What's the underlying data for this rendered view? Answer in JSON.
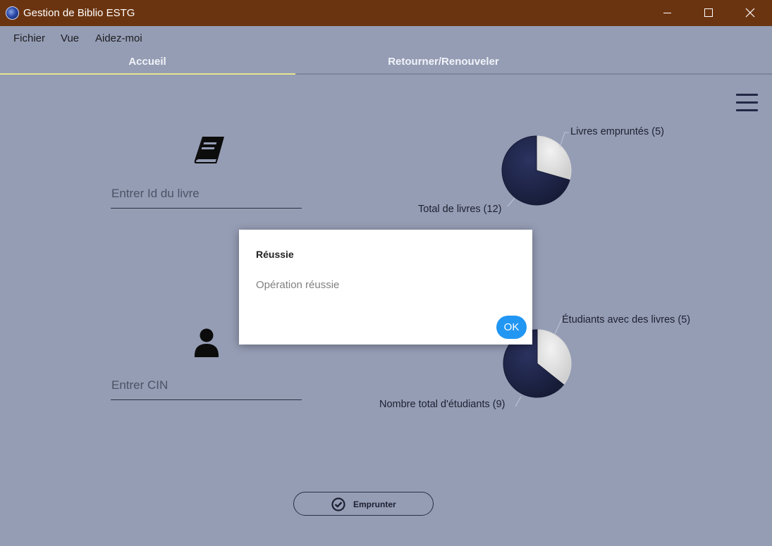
{
  "window": {
    "title": "Gestion de Biblio ESTG"
  },
  "menu": {
    "items": [
      "Fichier",
      "Vue",
      "Aidez-moi"
    ]
  },
  "tabs": [
    {
      "label": "Accueil",
      "active": true
    },
    {
      "label": "Retourner/Renouveler",
      "active": false
    }
  ],
  "form": {
    "book_id_placeholder": "Entrer Id du livre",
    "cin_placeholder": "Entrer CIN",
    "borrow_button_label": "Emprunter"
  },
  "chart_data": [
    {
      "type": "pie",
      "slices": [
        {
          "label": "Livres empruntés (5)",
          "value": 5,
          "color": "#e2e2e2"
        },
        {
          "label": "Total de livres (12)",
          "value": 12,
          "color": "#1e2545"
        }
      ]
    },
    {
      "type": "pie",
      "slices": [
        {
          "label": "Étudiants avec des livres (5)",
          "value": 5,
          "color": "#e2e2e2"
        },
        {
          "label": "Nombre total d'étudiants (9)",
          "value": 9,
          "color": "#1e2545"
        }
      ]
    }
  ],
  "dialog": {
    "title": "Réussie",
    "message": "Opération réussie",
    "ok_label": "OK"
  },
  "colors": {
    "titlebar": "#6b3410",
    "background": "#959db5",
    "accent_tab": "#e6e58e",
    "ok_button": "#2196f3"
  }
}
